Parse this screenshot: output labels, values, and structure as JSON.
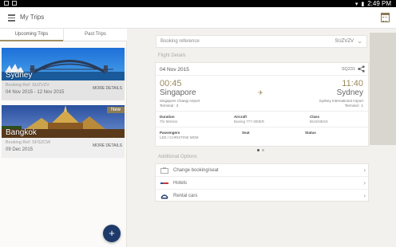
{
  "status_bar": {
    "time": "2:49 PM"
  },
  "app": {
    "title": "My Trips"
  },
  "tabs": [
    {
      "label": "Upcoming Trips",
      "active": true
    },
    {
      "label": "Past Trips",
      "active": false
    }
  ],
  "trips": [
    {
      "city": "Sydney",
      "booking_ref": "Booking Ref: SUZVZV",
      "dates": "04 Nov 2015 - 12 Nov 2015",
      "more": "MORE DETAILS",
      "badge": ""
    },
    {
      "city": "Bangkok",
      "booking_ref": "Booking Ref: SFSZCW",
      "dates": "09 Dec 2015",
      "more": "MORE DETAILS",
      "badge": "New"
    }
  ],
  "fab": {
    "label": "+"
  },
  "booking": {
    "label": "Booking reference",
    "value": "SUZVZV"
  },
  "flight_details": {
    "section_label": "Flight Details",
    "date": "04 Nov 2015",
    "flight_no": "SQ231",
    "departure": {
      "time": "00:45",
      "city": "Singapore",
      "airport": "Singapore Changi Airport",
      "terminal": "Terminal : 3"
    },
    "arrival": {
      "time": "11:40",
      "city": "Sydney",
      "airport": "Sydney International Airport",
      "terminal": "Terminal : 1"
    },
    "duration_label": "Duration",
    "duration": "7hr 55mins",
    "aircraft_label": "Aircraft",
    "aircraft": "Boeing 777-300ER",
    "class_label": "Class",
    "class": "BUSINESS",
    "passengers_label": "Passengers",
    "passengers": "LEE / CHRISTINE MDM",
    "seat_label": "Seat",
    "seat": "",
    "status_label": "Status",
    "status": ""
  },
  "additional_options": {
    "section_label": "Additional Options",
    "items": [
      {
        "label": "Change booking/seat",
        "icon": "suitcase-icon"
      },
      {
        "label": "Hotels",
        "icon": "hotels-icon"
      },
      {
        "label": "Rental cars",
        "icon": "rental-cars-icon"
      }
    ]
  },
  "colors": {
    "accent": "#9b8a5e",
    "fab": "#1e3a6b",
    "badge": "#8c7d58"
  }
}
